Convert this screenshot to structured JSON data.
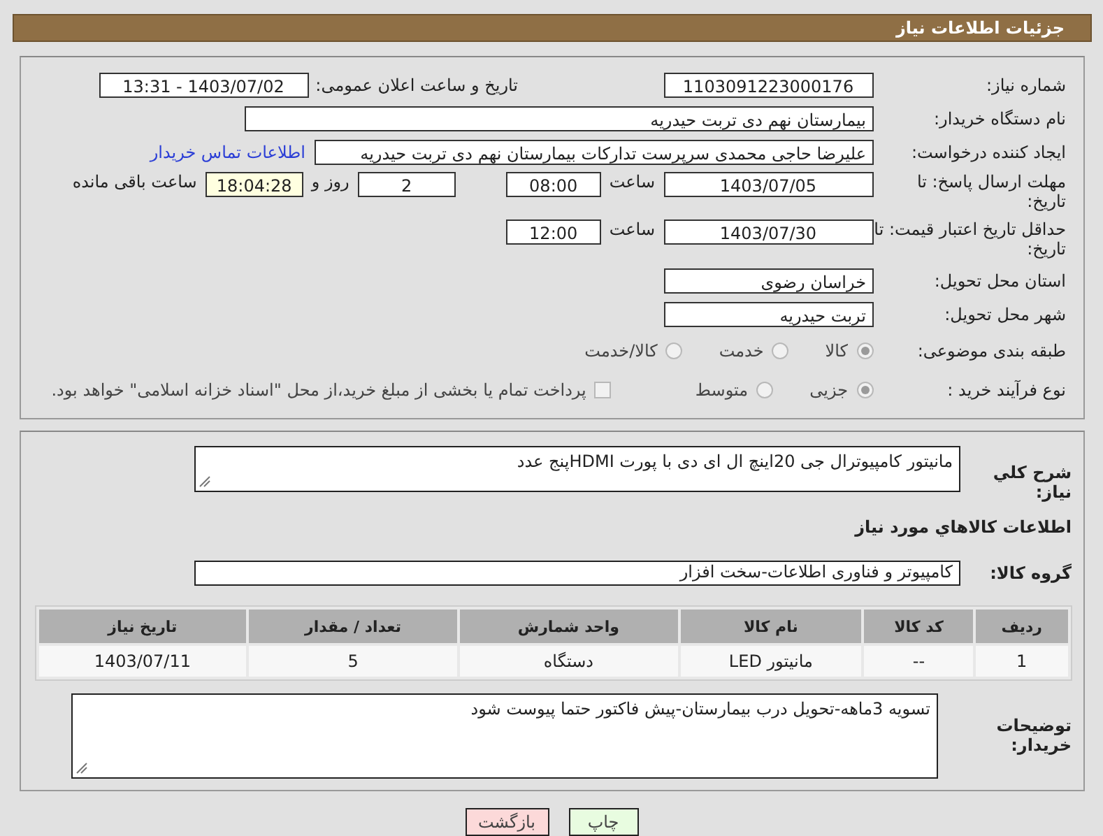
{
  "header": {
    "title": "جزئیات اطلاعات نیاز"
  },
  "details": {
    "need_number": {
      "label": "شماره نیاز:",
      "value": "1103091223000176"
    },
    "announce": {
      "label": "تاریخ و ساعت اعلان عمومی:",
      "value": "1403/07/02 - 13:31"
    },
    "buyer_org": {
      "label": "نام دستگاه خریدار:",
      "value": "بیمارستان نهم دی تربت حیدریه"
    },
    "requester": {
      "label": "ایجاد کننده درخواست:",
      "value": "علیرضا حاجی محمدی سرپرست تدارکات بیمارستان نهم دی تربت حیدریه",
      "link": "اطلاعات تماس خریدار"
    },
    "reply_deadline": {
      "label": "مهلت ارسال پاسخ: تا تاریخ:",
      "date": "1403/07/05",
      "time_label": "ساعت",
      "time": "08:00",
      "days": "2",
      "days_label": "روز و",
      "remaining": "18:04:28",
      "remaining_label": "ساعت باقی مانده"
    },
    "price_validity": {
      "label": "حداقل تاریخ اعتبار قیمت: تا تاریخ:",
      "date": "1403/07/30",
      "time_label": "ساعت",
      "time": "12:00"
    },
    "province": {
      "label": "استان محل تحویل:",
      "value": "خراسان رضوی"
    },
    "city": {
      "label": "شهر محل تحویل:",
      "value": "تربت حیدریه"
    },
    "category": {
      "label": "طبقه بندی موضوعی:",
      "options": [
        {
          "label": "کالا",
          "selected": true
        },
        {
          "label": "خدمت",
          "selected": false
        },
        {
          "label": "کالا/خدمت",
          "selected": false
        }
      ]
    },
    "process": {
      "label": "نوع فرآیند خرید :",
      "options": [
        {
          "label": "جزیی",
          "selected": true
        },
        {
          "label": "متوسط",
          "selected": false
        }
      ],
      "treasury": {
        "label": "پرداخت تمام یا بخشی از مبلغ خرید،از محل \"اسناد خزانه اسلامی\" خواهد بود.",
        "checked": false
      }
    }
  },
  "need": {
    "description": {
      "label": "شرح کلي نياز:",
      "value": "مانیتور کامپیوترال جی 20اینچ ال ای دی با پورت HDMIپنج عدد"
    },
    "goods_title": "اطلاعات كالاهاي مورد نياز",
    "group": {
      "label": "گروه کالا:",
      "value": "کامپیوتر و فناوری اطلاعات-سخت افزار"
    },
    "table": {
      "columns": [
        "ردیف",
        "کد کالا",
        "نام کالا",
        "واحد شمارش",
        "تعداد / مقدار",
        "تاریخ نیاز"
      ],
      "rows": [
        [
          "1",
          "--",
          "مانیتور LED",
          "دستگاه",
          "5",
          "1403/07/11"
        ]
      ]
    },
    "buyer_notes": {
      "label": "توضیحات خریدار:",
      "value": "تسویه 3ماهه-تحویل درب بیمارستان-پیش فاکتور حتما پیوست شود"
    }
  },
  "buttons": [
    {
      "label": "چاپ",
      "kind": "print"
    },
    {
      "label": "بازگشت",
      "kind": "back"
    }
  ]
}
